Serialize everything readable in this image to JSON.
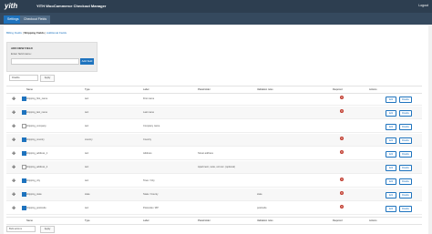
{
  "topbar": {
    "logo": "yith",
    "app_name": "YITH WooCommerce Checkout Manager",
    "logout": "Logout"
  },
  "tabs": [
    {
      "label": "Settings"
    },
    {
      "label": "Checkout Fields"
    }
  ],
  "breadcrumb": {
    "billing": "Billing Fields",
    "sep1": "|",
    "shipping": "Shipping Fields",
    "sep2": "|",
    "additional": "Additional Fields"
  },
  "add_field": {
    "title": "ADD NEW FIELD",
    "label": "Enter field name:",
    "button": "Add field"
  },
  "bulk": {
    "select_label": "Disable",
    "apply_label": "Apply",
    "select_label_bottom": "Bulk actions",
    "apply_label_bottom": "Apply"
  },
  "columns": {
    "name": "Name",
    "type": "Type",
    "label": "Label",
    "placeholder": "Placeholder",
    "validation": "Validation rules",
    "required": "Required",
    "actions": "Actions"
  },
  "rows": [
    {
      "name": "shipping_first_name",
      "type": "text",
      "label": "First name",
      "placeholder": "",
      "validation": "",
      "required": true,
      "checked": true,
      "edit": "Edit",
      "disable": "Disable"
    },
    {
      "name": "shipping_last_name",
      "type": "text",
      "label": "Last name",
      "placeholder": "",
      "validation": "",
      "required": true,
      "checked": true,
      "edit": "Edit",
      "disable": "Disable"
    },
    {
      "name": "shipping_company",
      "type": "text",
      "label": "Company name",
      "placeholder": "",
      "validation": "",
      "required": false,
      "checked": false,
      "edit": "Edit",
      "disable": "Disable"
    },
    {
      "name": "shipping_country",
      "type": "country",
      "label": "Country",
      "placeholder": "",
      "validation": "",
      "required": true,
      "checked": true,
      "edit": "Edit",
      "disable": "Disable"
    },
    {
      "name": "shipping_address_1",
      "type": "text",
      "label": "Address",
      "placeholder": "Street address",
      "validation": "",
      "required": true,
      "checked": true,
      "edit": "Edit",
      "disable": "Disable"
    },
    {
      "name": "shipping_address_2",
      "type": "text",
      "label": "",
      "placeholder": "Apartment, suite, unit etc. (optional)",
      "validation": "",
      "required": false,
      "checked": false,
      "edit": "Edit",
      "disable": "Disable"
    },
    {
      "name": "shipping_city",
      "type": "text",
      "label": "Town / City",
      "placeholder": "",
      "validation": "",
      "required": true,
      "checked": true,
      "edit": "Edit",
      "disable": "Disable"
    },
    {
      "name": "shipping_state",
      "type": "state",
      "label": "State / County",
      "placeholder": "",
      "validation": "state",
      "required": true,
      "checked": true,
      "edit": "Edit",
      "disable": "Disable"
    },
    {
      "name": "shipping_postcode",
      "type": "text",
      "label": "Postcode / ZIP",
      "placeholder": "",
      "validation": "postcode",
      "required": true,
      "checked": true,
      "edit": "Edit",
      "disable": "Disable"
    }
  ],
  "colors": {
    "topbar": "#2d3e50",
    "accent": "#1e73be",
    "required": "#c0392b"
  }
}
